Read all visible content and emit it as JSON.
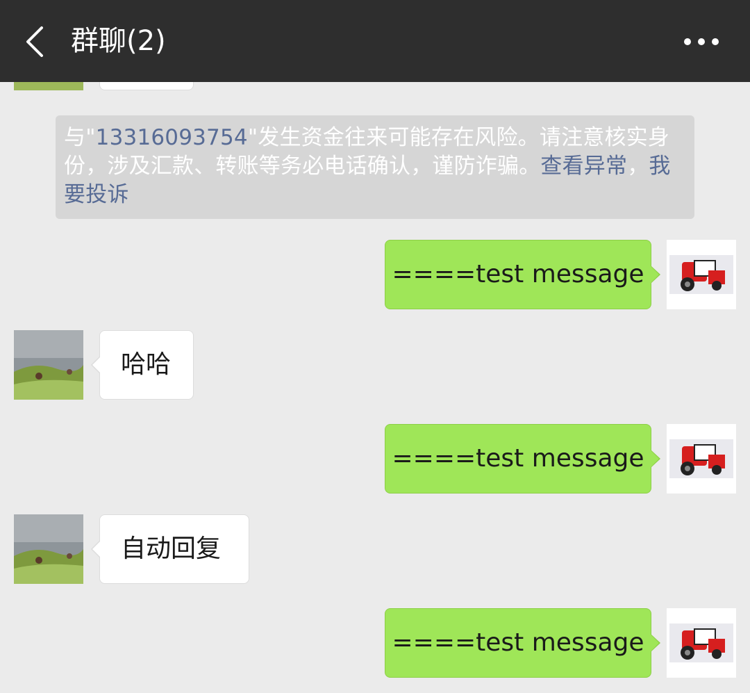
{
  "header": {
    "title": "群聊(2)",
    "back_icon": "chevron-left-icon",
    "more_icon": "more-dots-icon"
  },
  "system_notice": {
    "prefix": "与\"",
    "phone": "13316093754",
    "text": "\"发生资金往来可能存在风险。请注意核实身份，涉及汇款、转账等务必电话确认，谨防诈骗。",
    "link_check": "查看异常",
    "separator": "，",
    "link_report": "我要投诉"
  },
  "messages": [
    {
      "direction": "outgoing",
      "text": "====test message"
    },
    {
      "direction": "incoming",
      "text": "哈哈"
    },
    {
      "direction": "outgoing",
      "text": "====test message"
    },
    {
      "direction": "incoming",
      "text": "自动回复"
    },
    {
      "direction": "outgoing",
      "text": "====test message"
    }
  ],
  "colors": {
    "header_bg": "#2e2e2e",
    "chat_bg": "#ebebeb",
    "outgoing_bubble": "#9fe658",
    "incoming_bubble": "#ffffff",
    "notice_bg": "#d6d6d6",
    "link": "#576b95"
  }
}
